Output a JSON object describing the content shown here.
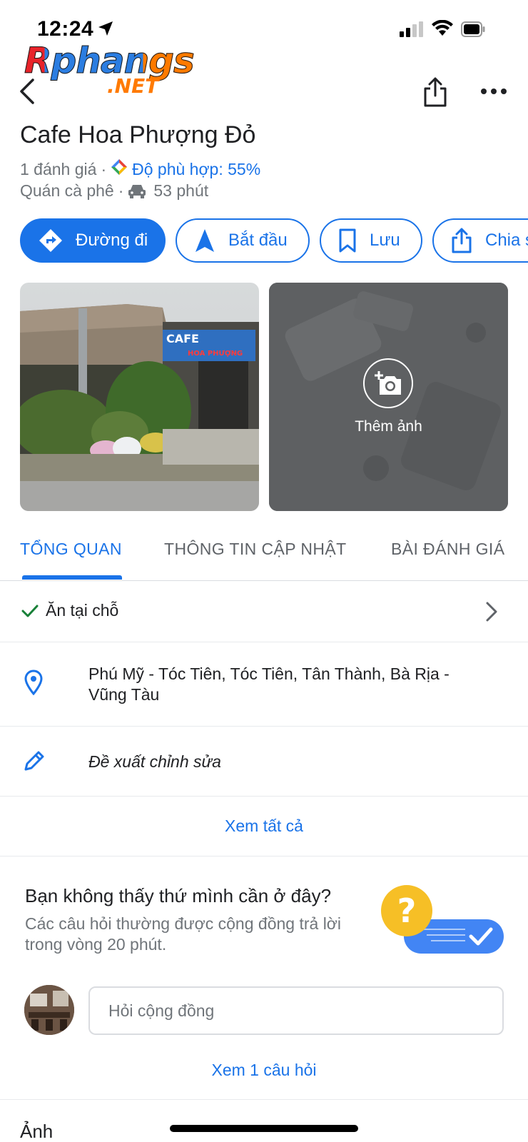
{
  "status_bar": {
    "time": "12:24"
  },
  "watermark": {
    "brand": "Rphangs",
    "suffix": ".NET"
  },
  "header": {
    "back_icon": "chevron-left-icon",
    "share_icon": "share-icon",
    "more_icon": "more-horiz-icon"
  },
  "place": {
    "name": "Cafe Hoa Phượng Đỏ",
    "reviews": "1 đánh giá",
    "separator": "·",
    "match": "Độ phù hợp: 55%",
    "category": "Quán cà phê",
    "drive_time": "53 phút"
  },
  "actions": [
    {
      "label": "Đường đi",
      "icon": "directions-icon"
    },
    {
      "label": "Bắt đầu",
      "icon": "navigation-icon"
    },
    {
      "label": "Lưu",
      "icon": "bookmark-icon"
    },
    {
      "label": "Chia sẻ",
      "icon": "share-icon"
    }
  ],
  "photos": {
    "add_label": "Thêm ảnh",
    "sign_text": "CAFE",
    "sign_sub": "HOA PHƯỢNG"
  },
  "tabs": [
    {
      "label": "TỔNG QUAN",
      "active": true
    },
    {
      "label": "THÔNG TIN CẬP NHẬT",
      "active": false
    },
    {
      "label": "BÀI ĐÁNH GIÁ",
      "active": false
    }
  ],
  "overview": {
    "dine_in": "Ăn tại chỗ",
    "address": "Phú Mỹ - Tóc Tiên, Tóc Tiên, Tân Thành, Bà Rịa - Vũng Tàu",
    "suggest_edit": "Đề xuất chỉnh sửa",
    "see_all": "Xem tất cả"
  },
  "qa": {
    "title": "Bạn không thấy thứ mình cần ở đây?",
    "subtitle": "Các câu hỏi thường được cộng đồng trả lời trong vòng 20 phút.",
    "input_placeholder": "Hỏi cộng đồng",
    "view_questions": "Xem 1 câu hỏi"
  },
  "photos_section": {
    "heading": "Ảnh"
  },
  "colors": {
    "accent": "#1a73e8",
    "text": "#202124",
    "secondary": "#70757a",
    "qa_yellow": "#f6bf26"
  }
}
